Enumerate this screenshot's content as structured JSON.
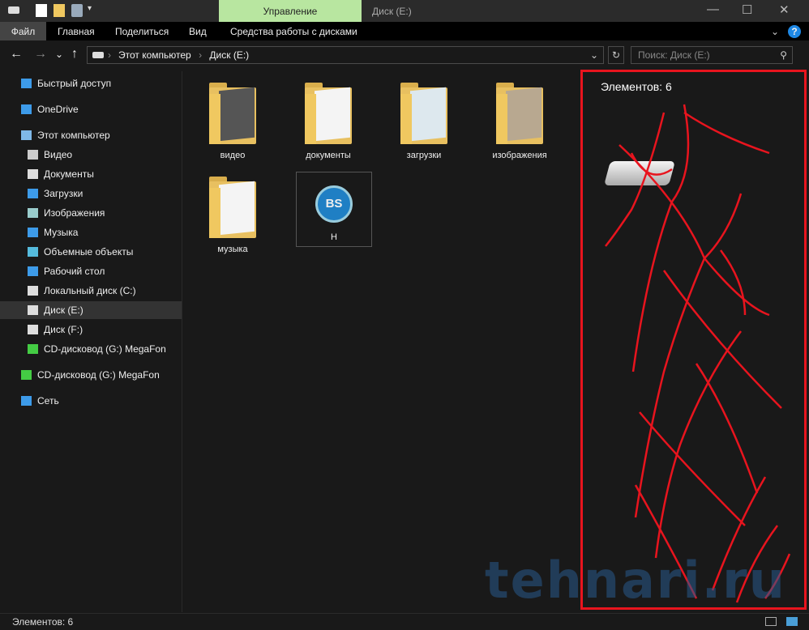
{
  "titlebar": {
    "context_tab": "Управление",
    "title": "Диск (E:)",
    "minimize": "—",
    "maximize": "☐",
    "close": "✕"
  },
  "ribbon": {
    "tabs": [
      "Файл",
      "Главная",
      "Поделиться",
      "Вид",
      "Средства работы с дисками"
    ],
    "help": "?",
    "expand": "⌄"
  },
  "address": {
    "back": "←",
    "forward": "→",
    "recent": "⌄",
    "up": "↑",
    "crumbs": [
      "Этот компьютер",
      "Диск (E:)"
    ],
    "sep": "›",
    "refresh": "↻",
    "search_placeholder": "Поиск: Диск (E:)",
    "search_icon": "⚲"
  },
  "sidebar": {
    "items": [
      "Быстрый доступ",
      "OneDrive",
      "Этот компьютер",
      "Видео",
      "Документы",
      "Загрузки",
      "Изображения",
      "Музыка",
      "Объемные объекты",
      "Рабочий стол",
      "Локальный диск (C:)",
      "Диск (E:)",
      "Диск  (F:)",
      "CD-дисковод (G:) MegaFon",
      "CD-дисковод (G:) MegaFon",
      "Сеть"
    ]
  },
  "content": {
    "items": [
      "видео",
      "документы",
      "загрузки",
      "изображения",
      "музыка",
      "H"
    ],
    "app_icon_text": "BS"
  },
  "details": {
    "count": "Элементов: 6"
  },
  "status": {
    "count": "Элементов: 6"
  },
  "watermark": "tehnari.ru",
  "colors": {
    "accent": "#b8e6a0",
    "highlight": "#e8141e"
  }
}
